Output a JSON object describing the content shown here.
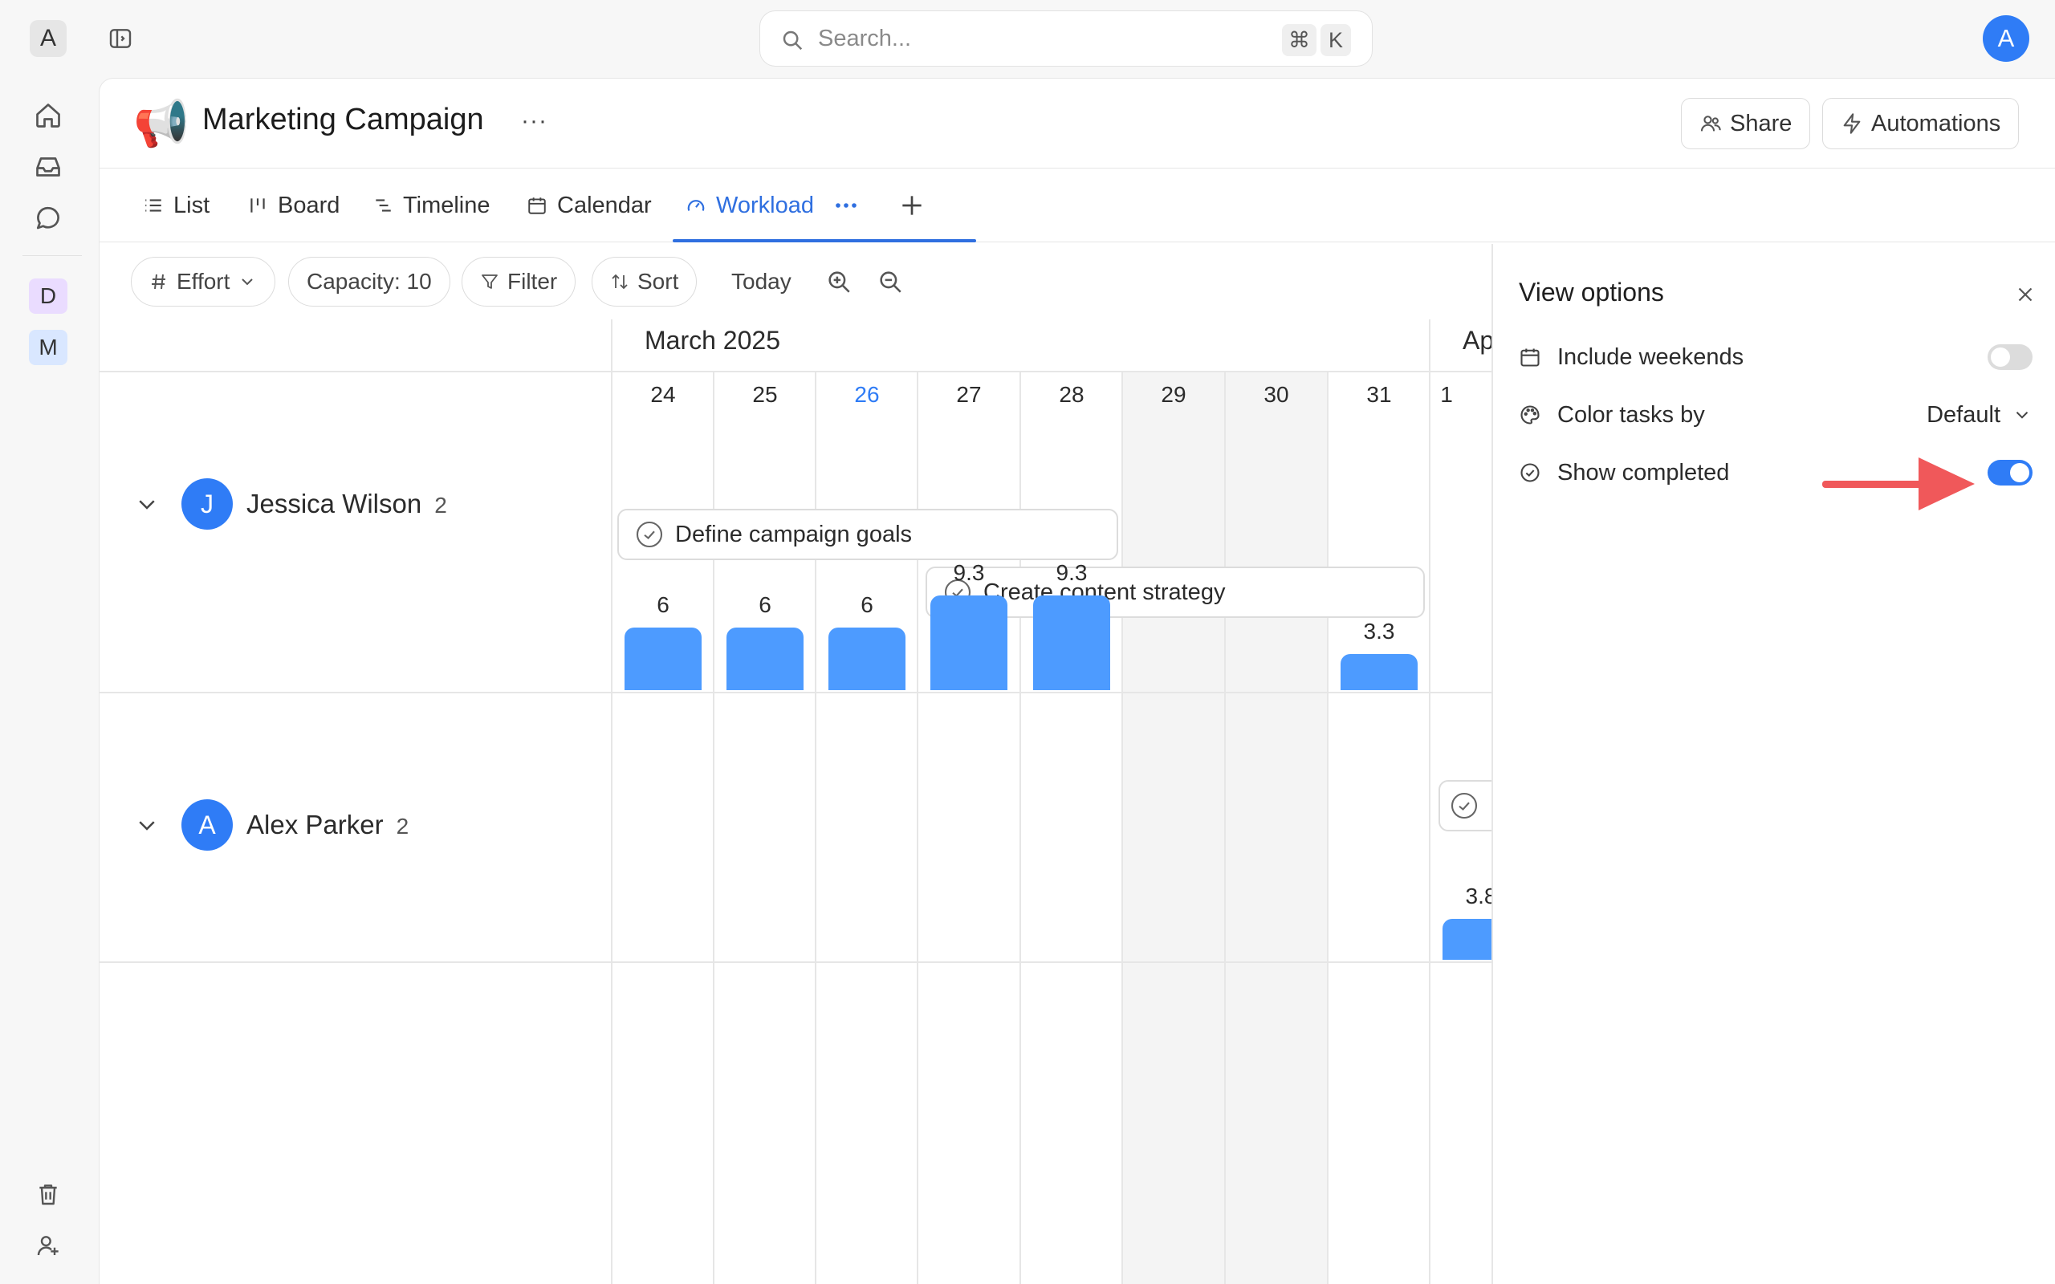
{
  "workspace": {
    "initial": "A"
  },
  "search": {
    "placeholder": "Search...",
    "shortcut_mod": "⌘",
    "shortcut_key": "K"
  },
  "user": {
    "initial": "A"
  },
  "spaces": [
    {
      "initial": "D",
      "color": "#eadcff"
    },
    {
      "initial": "M",
      "color": "#d9e7ff"
    }
  ],
  "page": {
    "emoji": "📢",
    "title": "Marketing Campaign",
    "more": "···"
  },
  "header_actions": {
    "share": "Share",
    "automations": "Automations"
  },
  "views": {
    "tabs": [
      {
        "label": "List",
        "icon": "list-icon"
      },
      {
        "label": "Board",
        "icon": "board-icon"
      },
      {
        "label": "Timeline",
        "icon": "timeline-icon"
      },
      {
        "label": "Calendar",
        "icon": "calendar-icon"
      },
      {
        "label": "Workload",
        "icon": "gauge-icon",
        "active": true
      }
    ]
  },
  "toolbar": {
    "effort": "Effort",
    "capacity": "Capacity: 10",
    "filter": "Filter",
    "sort": "Sort",
    "today": "Today"
  },
  "calendar": {
    "month": "March 2025",
    "next_month_partial": "Ap",
    "days": [
      "24",
      "25",
      "26",
      "27",
      "28",
      "29",
      "30",
      "31",
      "1"
    ],
    "today_index": 2,
    "weekend_indices": [
      5,
      6
    ]
  },
  "people": [
    {
      "name": "Jessica Wilson",
      "initial": "J",
      "count": "2",
      "tasks": [
        "Define campaign goals",
        "Create content strategy"
      ],
      "workload": [
        {
          "day": "24",
          "value": "6"
        },
        {
          "day": "25",
          "value": "6"
        },
        {
          "day": "26",
          "value": "6"
        },
        {
          "day": "27",
          "value": "9.3"
        },
        {
          "day": "28",
          "value": "9.3"
        },
        {
          "day": "31",
          "value": "3.3"
        }
      ]
    },
    {
      "name": "Alex Parker",
      "initial": "A",
      "count": "2",
      "workload": [
        {
          "day": "1",
          "value": "3.8"
        }
      ]
    }
  ],
  "view_options": {
    "title": "View options",
    "include_weekends": {
      "label": "Include weekends",
      "enabled": false
    },
    "color_tasks_by": {
      "label": "Color tasks by",
      "value": "Default"
    },
    "show_completed": {
      "label": "Show completed",
      "enabled": true
    }
  },
  "colors": {
    "accent": "#2f7cf6",
    "bar": "#4d9bff",
    "annotation_arrow": "#f0585a"
  }
}
